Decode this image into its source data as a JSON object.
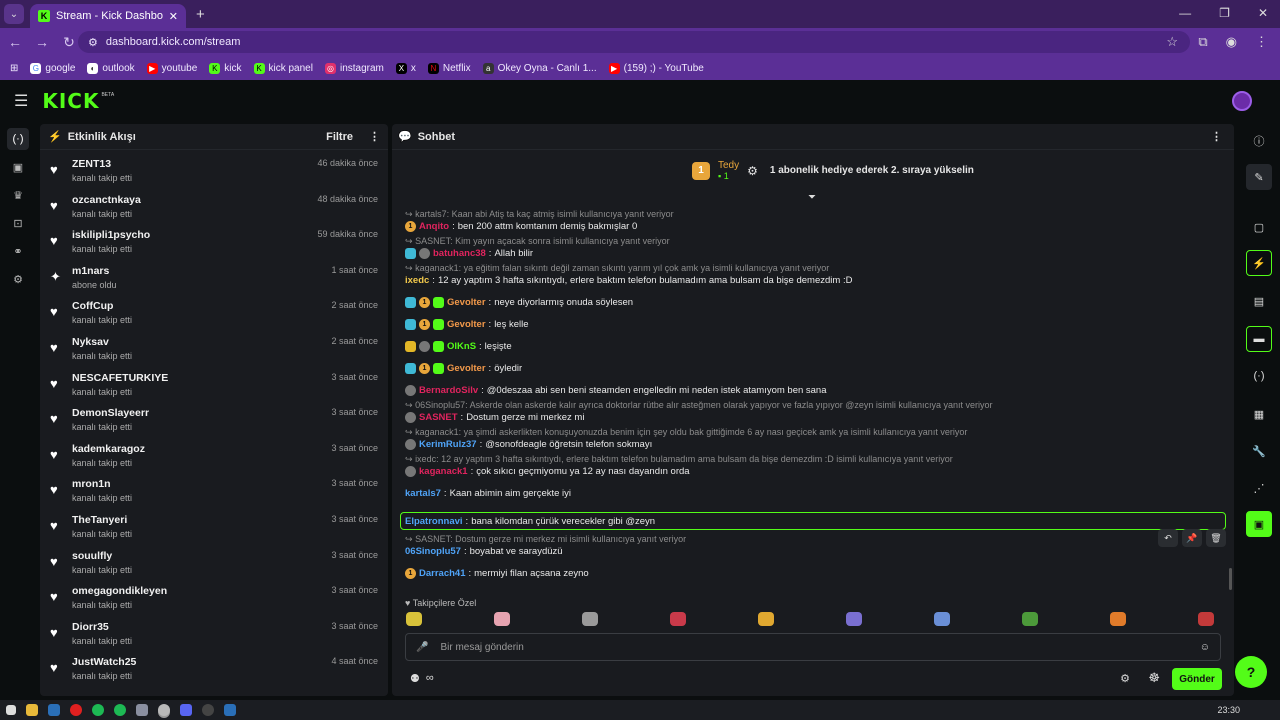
{
  "browser": {
    "tab_title": "Stream - Kick Dashboard",
    "url": "dashboard.kick.com/stream",
    "bookmarks": [
      {
        "label": "google",
        "color": "#ffffff"
      },
      {
        "label": "outlook",
        "color": "#ffffff"
      },
      {
        "label": "youtube",
        "color": "#ff0000"
      },
      {
        "label": "kick",
        "color": "#53fc18"
      },
      {
        "label": "kick panel",
        "color": "#53fc18"
      },
      {
        "label": "instagram",
        "color": "#e1306c"
      },
      {
        "label": "x",
        "color": "#000000"
      },
      {
        "label": "Netflix",
        "color": "#e50914"
      },
      {
        "label": "Okey Oyna - Canlı 1...",
        "color": "#333333"
      },
      {
        "label": "(159) ;) - YouTube",
        "color": "#ff0000"
      }
    ]
  },
  "kick": {
    "logo": "KICK",
    "beta": "BETA"
  },
  "activity": {
    "title": "Etkinlik Akışı",
    "filter": "Filtre",
    "items": [
      {
        "name": "ZENT13",
        "sub": "kanalı takip etti",
        "time": "46 dakika önce",
        "icon": "heart"
      },
      {
        "name": "ozcanctnkaya",
        "sub": "kanalı takip etti",
        "time": "48 dakika önce",
        "icon": "heart"
      },
      {
        "name": "iskilipli1psycho",
        "sub": "kanalı takip etti",
        "time": "59 dakika önce",
        "icon": "heart"
      },
      {
        "name": "m1nars",
        "sub": "abone oldu",
        "time": "1 saat önce",
        "icon": "star"
      },
      {
        "name": "CoffCup",
        "sub": "kanalı takip etti",
        "time": "2 saat önce",
        "icon": "heart"
      },
      {
        "name": "Nyksav",
        "sub": "kanalı takip etti",
        "time": "2 saat önce",
        "icon": "heart"
      },
      {
        "name": "NESCAFETURKIYE",
        "sub": "kanalı takip etti",
        "time": "3 saat önce",
        "icon": "heart"
      },
      {
        "name": "DemonSlayeerr",
        "sub": "kanalı takip etti",
        "time": "3 saat önce",
        "icon": "heart"
      },
      {
        "name": "kademkaragoz",
        "sub": "kanalı takip etti",
        "time": "3 saat önce",
        "icon": "heart"
      },
      {
        "name": "mron1n",
        "sub": "kanalı takip etti",
        "time": "3 saat önce",
        "icon": "heart"
      },
      {
        "name": "TheTanyeri",
        "sub": "kanalı takip etti",
        "time": "3 saat önce",
        "icon": "heart"
      },
      {
        "name": "souulfly",
        "sub": "kanalı takip etti",
        "time": "3 saat önce",
        "icon": "heart"
      },
      {
        "name": "omegagondikleyen",
        "sub": "kanalı takip etti",
        "time": "3 saat önce",
        "icon": "heart"
      },
      {
        "name": "Diorr35",
        "sub": "kanalı takip etti",
        "time": "3 saat önce",
        "icon": "heart"
      },
      {
        "name": "JustWatch25",
        "sub": "kanalı takip etti",
        "time": "4 saat önce",
        "icon": "heart"
      }
    ]
  },
  "chat": {
    "title": "Sohbet",
    "goal_user": "Tedy",
    "goal_count": "1",
    "goal_rank": "1",
    "goal_text": "1 abonelik hediye ederek 2. sıraya yükselin",
    "messages": [
      {
        "reply": "kartals7: Kaan abi Atiş ta kaç atmiş isimli kullanıcıya yanıt veriyor",
        "badges": [
          "gold"
        ],
        "user": "Anqito",
        "color": "#e0245e",
        "text": "ben 200 attm komtanım demiş bakmışlar 0"
      },
      {
        "reply": "SASNET: Kim yayın açacak sonra isimli kullanıcıya yanıt veriyor",
        "badges": [
          "blue",
          "av"
        ],
        "user": "batuhanc38",
        "color": "#e0245e",
        "text": "Allah bilir"
      },
      {
        "reply": "kaganack1: ya eğitim falan sıkıntı değil zaman sıkıntı yarım yıl çok amk ya isimli kullanıcıya yanıt veriyor",
        "badges": [],
        "user": "ixedc",
        "color": "#f2c94c",
        "text": "12 ay yaptım 3 hafta sıkıntıydı, erlere baktım telefon bulamadım ama bulsam da bişe demezdim :D"
      },
      {
        "reply": "",
        "badges": [
          "blue",
          "gold",
          "green"
        ],
        "user": "Gevolter",
        "color": "#f2994a",
        "text": "neye diyorlarmış onuda söylesen"
      },
      {
        "reply": "",
        "badges": [
          "blue",
          "gold",
          "green"
        ],
        "user": "Gevolter",
        "color": "#f2994a",
        "text": "leş kelle"
      },
      {
        "reply": "",
        "badges": [
          "crown",
          "av",
          "green"
        ],
        "user": "OlKnS",
        "color": "#53fc18",
        "text": "leşişte"
      },
      {
        "reply": "",
        "badges": [
          "blue",
          "gold",
          "green"
        ],
        "user": "Gevolter",
        "color": "#f2994a",
        "text": "öyledir"
      },
      {
        "reply": "",
        "badges": [
          "av"
        ],
        "user": "BernardoSilv",
        "color": "#e0245e",
        "text": "@0deszaa abi sen beni steamden engelledin mi neden istek atamıyom ben sana"
      },
      {
        "reply": "06Sinoplu57: Askerde olan askerde kalır ayrıca doktorlar rütbe alır asteğmen olarak yapıyor ve fazla yıpıyor @zeyn isimli kullanıcıya yanıt veriyor",
        "badges": [
          "av"
        ],
        "user": "SASNET",
        "color": "#e0245e",
        "text": "Dostum gerze mi merkez mi"
      },
      {
        "reply": "kaganack1: ya şimdi askerlikten konuşuyonuzda benim için şey oldu bak gittiğimde 6 ay nası geçicek amk ya isimli kullanıcıya yanıt veriyor",
        "badges": [
          "av"
        ],
        "user": "KerimRulz37",
        "color": "#4fa3f7",
        "text": "@sonofdeagle öğretsin telefon sokmayı"
      },
      {
        "reply": "ixedc: 12 ay yaptım 3 hafta sıkıntıydı, erlere baktım telefon bulamadım ama bulsam da bişe demezdim :D isimli kullanıcıya yanıt veriyor",
        "badges": [
          "av"
        ],
        "user": "kaganack1",
        "color": "#e0245e",
        "text": "çok sıkıcı geçmiyomu ya 12 ay nası dayandın orda"
      },
      {
        "reply": "",
        "badges": [],
        "user": "kartals7",
        "color": "#4fa3f7",
        "text": "Kaan abimin aim gerçekte iyi"
      },
      {
        "reply": "",
        "badges": [],
        "user": "Elpatronnavi",
        "color": "#4fa3f7",
        "text": "bana kilomdan çürük verecekler gibi @zeyn",
        "highlight": true
      },
      {
        "reply": "SASNET: Dostum gerze mi merkez mi isimli kullanıcıya yanıt veriyor",
        "badges": [],
        "user": "06Sinoplu57",
        "color": "#4fa3f7",
        "text": "boyabat ve saraydüzü"
      },
      {
        "reply": "",
        "badges": [
          "gold"
        ],
        "user": "Darrach41",
        "color": "#4fa3f7",
        "text": "mermiyi filan açsana zeyno"
      }
    ],
    "emote_section": "Takipçilere Özel",
    "emote_colors": [
      "#d8c23a",
      "#e6a3b0",
      "#9a9a9a",
      "#c93a4a",
      "#e0a830",
      "#7a6fd0",
      "#6a8fd6",
      "#4c9a3a",
      "#e07b2a",
      "#c33a3a"
    ],
    "input_placeholder": "Bir mesaj gönderin",
    "send": "Gönder"
  },
  "taskbar": {
    "clock": "23:30"
  }
}
